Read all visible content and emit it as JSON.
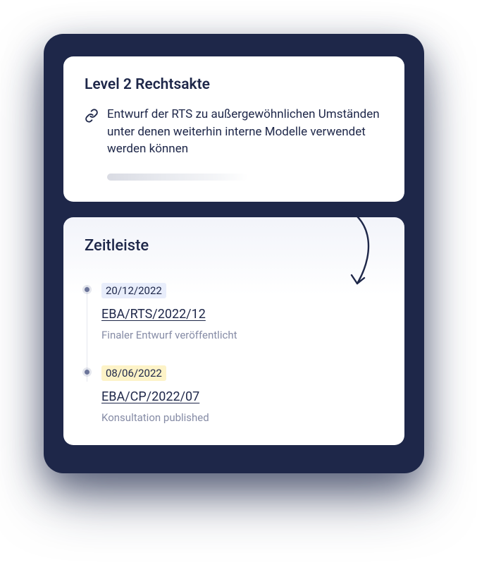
{
  "card1": {
    "title": "Level 2 Rechtsakte",
    "link_text": "Entwurf der RTS zu außergewöhnlichen Umständen unter denen weiterhin interne Modelle verwendet werden können"
  },
  "card2": {
    "title": "Zeitleiste",
    "items": [
      {
        "date": "20/12/2022",
        "ref": "EBA/RTS/2022/12",
        "desc": "Finaler Entwurf veröffentlicht",
        "color": "blue"
      },
      {
        "date": "08/06/2022",
        "ref": "EBA/CP/2022/07",
        "desc": "Konsultation published",
        "color": "yellow"
      }
    ]
  }
}
